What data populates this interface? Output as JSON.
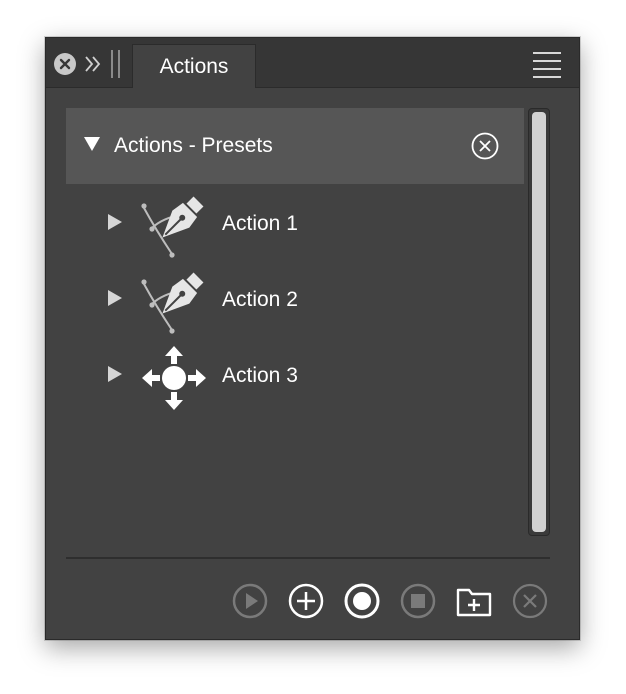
{
  "panel": {
    "tab_label": "Actions",
    "icons": {
      "close": "close-icon",
      "collapse": "double-chevron-right-icon",
      "grip": "drag-grip-icon",
      "menu": "hamburger-menu-icon"
    }
  },
  "group": {
    "title": "Actions - Presets",
    "expanded": true,
    "remove_icon": "remove-circle-icon"
  },
  "actions": [
    {
      "label": "Action 1",
      "icon": "pen-tool-icon",
      "expanded": false
    },
    {
      "label": "Action 2",
      "icon": "pen-tool-icon",
      "expanded": false
    },
    {
      "label": "Action 3",
      "icon": "move-tool-icon",
      "expanded": false
    }
  ],
  "footer": {
    "buttons": [
      {
        "name": "play",
        "icon": "play-circle-icon",
        "enabled": false
      },
      {
        "name": "add",
        "icon": "add-circle-icon",
        "enabled": true
      },
      {
        "name": "record",
        "icon": "record-circle-icon",
        "enabled": true
      },
      {
        "name": "stop",
        "icon": "stop-circle-icon",
        "enabled": false
      },
      {
        "name": "new-folder",
        "icon": "new-folder-icon",
        "enabled": true
      },
      {
        "name": "delete",
        "icon": "delete-circle-icon",
        "enabled": false
      }
    ]
  },
  "colors": {
    "panel_bg": "#424242",
    "header_bg": "#565656",
    "titlebar_bg": "#363636",
    "text": "#ffffff",
    "disabled": "#7a7a7a"
  }
}
